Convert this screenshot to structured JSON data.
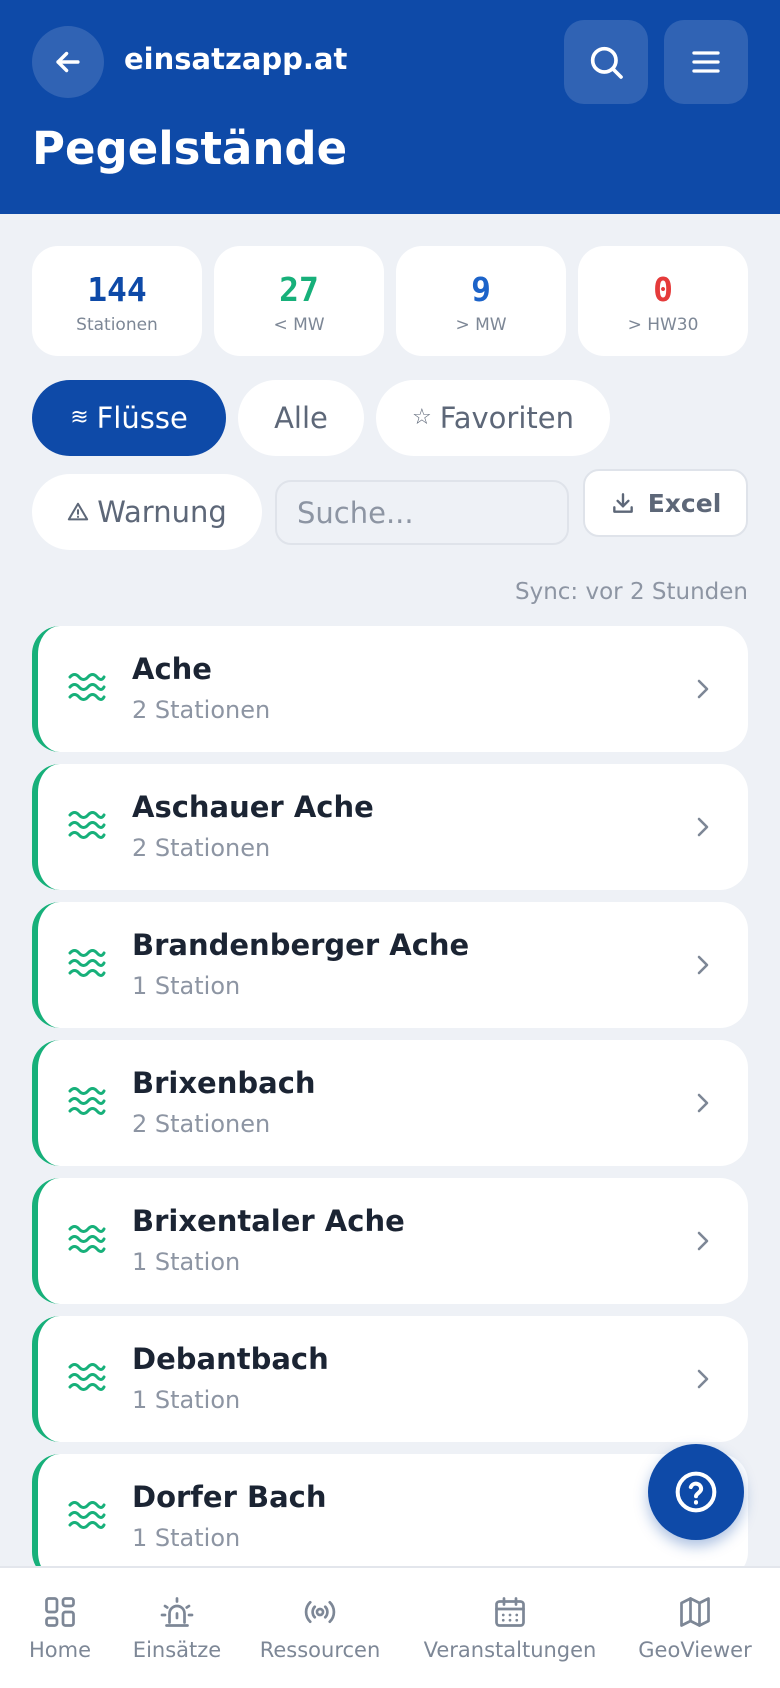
{
  "header": {
    "site_name": "einsatzapp.at",
    "page_title": "Pegelstände",
    "color": "#0e4aa8"
  },
  "stats": [
    {
      "value": "144",
      "label": "Stationen",
      "color": "#0e4aa8"
    },
    {
      "value": "27",
      "label": "< MW",
      "color": "#17b07a"
    },
    {
      "value": "9",
      "label": "> MW",
      "color": "#1c63c9"
    },
    {
      "value": "0",
      "label": "> HW30",
      "color": "#e53b3b"
    }
  ],
  "filters": {
    "fluesse": "Flüsse",
    "alle": "Alle",
    "favoriten": "Favoriten",
    "warnung": "Warnung",
    "active": "Flüsse"
  },
  "search": {
    "placeholder": "Suche...",
    "value": ""
  },
  "excel_label": "Excel",
  "sync_text": "Sync: vor 2 Stunden",
  "rivers": [
    {
      "name": "Ache",
      "stations": "2 Stationen"
    },
    {
      "name": "Aschauer Ache",
      "stations": "2 Stationen"
    },
    {
      "name": "Brandenberger Ache",
      "stations": "1 Station"
    },
    {
      "name": "Brixenbach",
      "stations": "2 Stationen"
    },
    {
      "name": "Brixentaler Ache",
      "stations": "1 Station"
    },
    {
      "name": "Debantbach",
      "stations": "1 Station"
    },
    {
      "name": "Dorfer Bach",
      "stations": "1 Station"
    }
  ],
  "nav": [
    {
      "label": "Home",
      "icon": "grid-icon"
    },
    {
      "label": "Einsätze",
      "icon": "siren-icon"
    },
    {
      "label": "Ressourcen",
      "icon": "radio-icon"
    },
    {
      "label": "Veranstaltungen",
      "icon": "calendar-icon"
    },
    {
      "label": "GeoViewer",
      "icon": "map-icon"
    }
  ]
}
